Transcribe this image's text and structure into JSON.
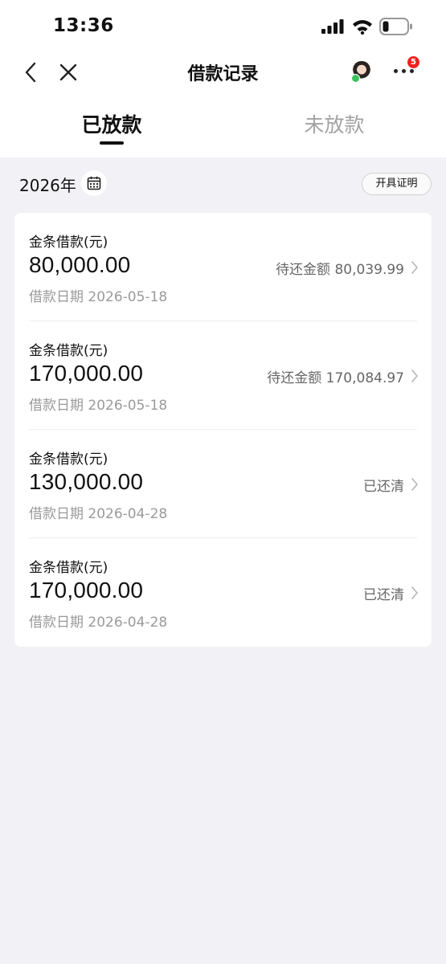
{
  "status_bar": {
    "time": "13:36"
  },
  "nav": {
    "title": "借款记录",
    "more_badge": "5"
  },
  "tabs": [
    {
      "label": "已放款",
      "active": true
    },
    {
      "label": "未放款",
      "active": false
    }
  ],
  "filter": {
    "year": "2026年",
    "certificate_button": "开具证明"
  },
  "loans": [
    {
      "type": "金条借款(元)",
      "amount": "80,000.00",
      "date": "借款日期 2026-05-18",
      "status": "待还金额 80,039.99"
    },
    {
      "type": "金条借款(元)",
      "amount": "170,000.00",
      "date": "借款日期 2026-05-18",
      "status": "待还金额 170,084.97"
    },
    {
      "type": "金条借款(元)",
      "amount": "130,000.00",
      "date": "借款日期 2026-04-28",
      "status": "已还清"
    },
    {
      "type": "金条借款(元)",
      "amount": "170,000.00",
      "date": "借款日期 2026-04-28",
      "status": "已还清"
    }
  ],
  "icons": {
    "back": "chevron-left-icon",
    "close": "close-icon",
    "calendar": "calendar-icon",
    "more": "more-dots-icon",
    "row_arrow": "chevron-right-icon"
  },
  "colors": {
    "background": "#f2f2f6",
    "card": "#ffffff",
    "badge": "#ee2222",
    "muted": "#9a9a9a"
  }
}
